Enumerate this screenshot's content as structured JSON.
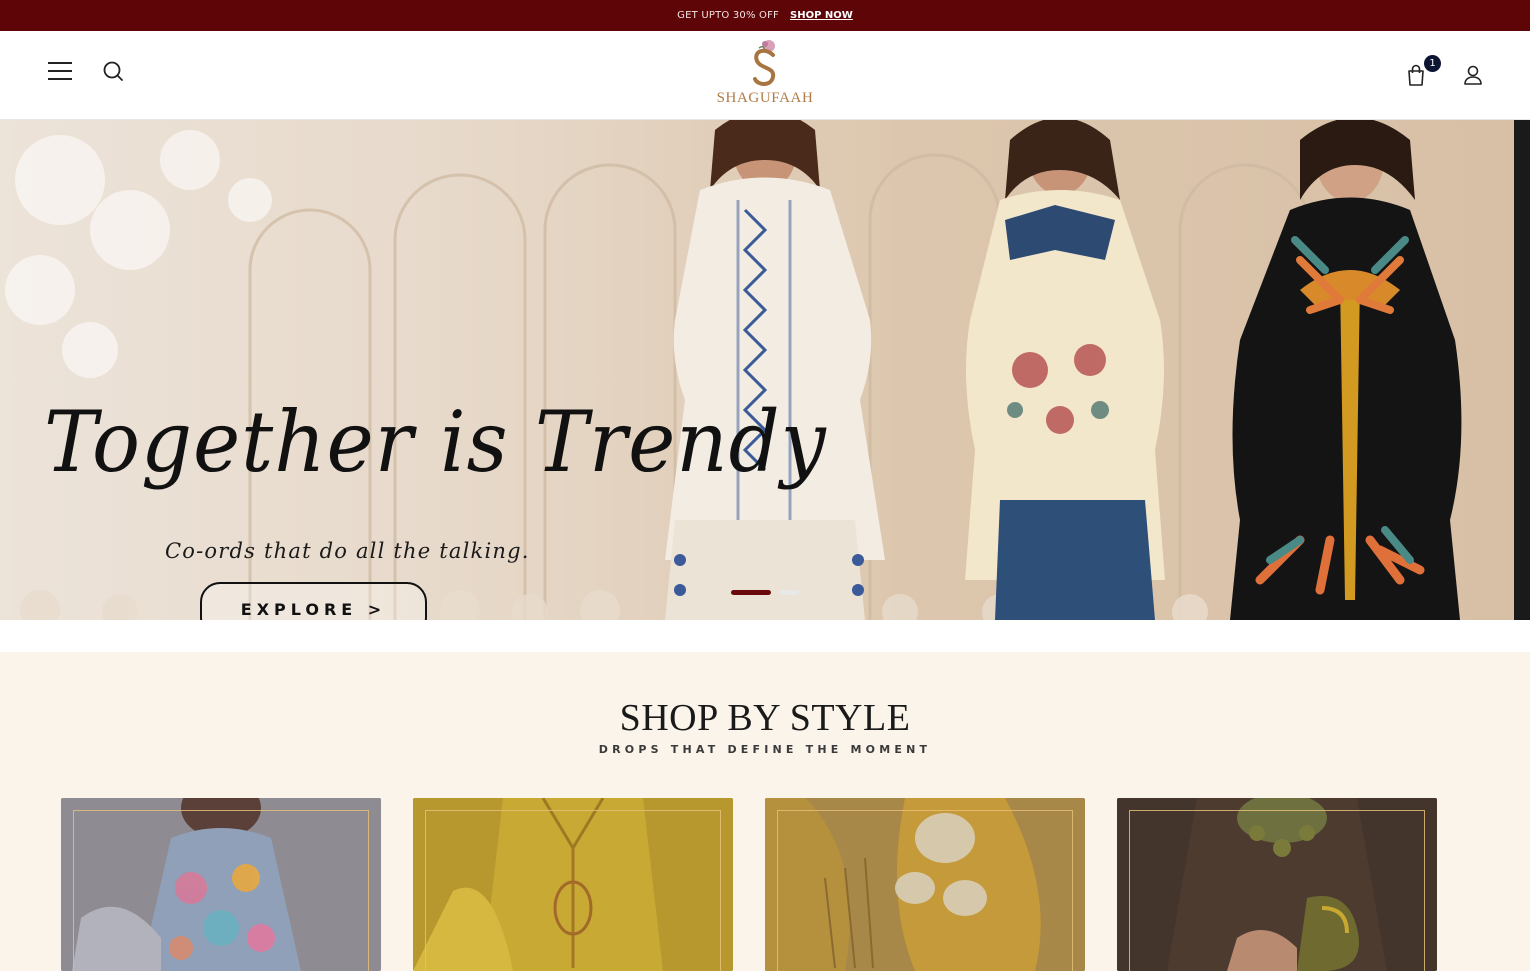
{
  "announcement": {
    "text": "GET UPTO 30% OFF",
    "link": "SHOP NOW"
  },
  "header": {
    "logo_text": "SHAGUFAAH",
    "cart_count": "1",
    "icons": [
      "menu-icon",
      "search-icon",
      "shopping-bag-icon",
      "user-icon"
    ]
  },
  "hero": {
    "title": "Together is Trendy",
    "subtitle": "Co-ords that do all the talking.",
    "button": "EXPLORE >",
    "slides_total": 2,
    "active_slide": 1
  },
  "shop_by_style": {
    "title": "SHOP BY STYLE",
    "subtitle": "DROPS THAT DEFINE THE MOMENT",
    "card_count": 4
  },
  "colors": {
    "announcement_bg": "#5e0508",
    "brand_gold": "#b07b45",
    "active_dot": "#6b0a0e",
    "section_bg": "#fbf4ea"
  }
}
